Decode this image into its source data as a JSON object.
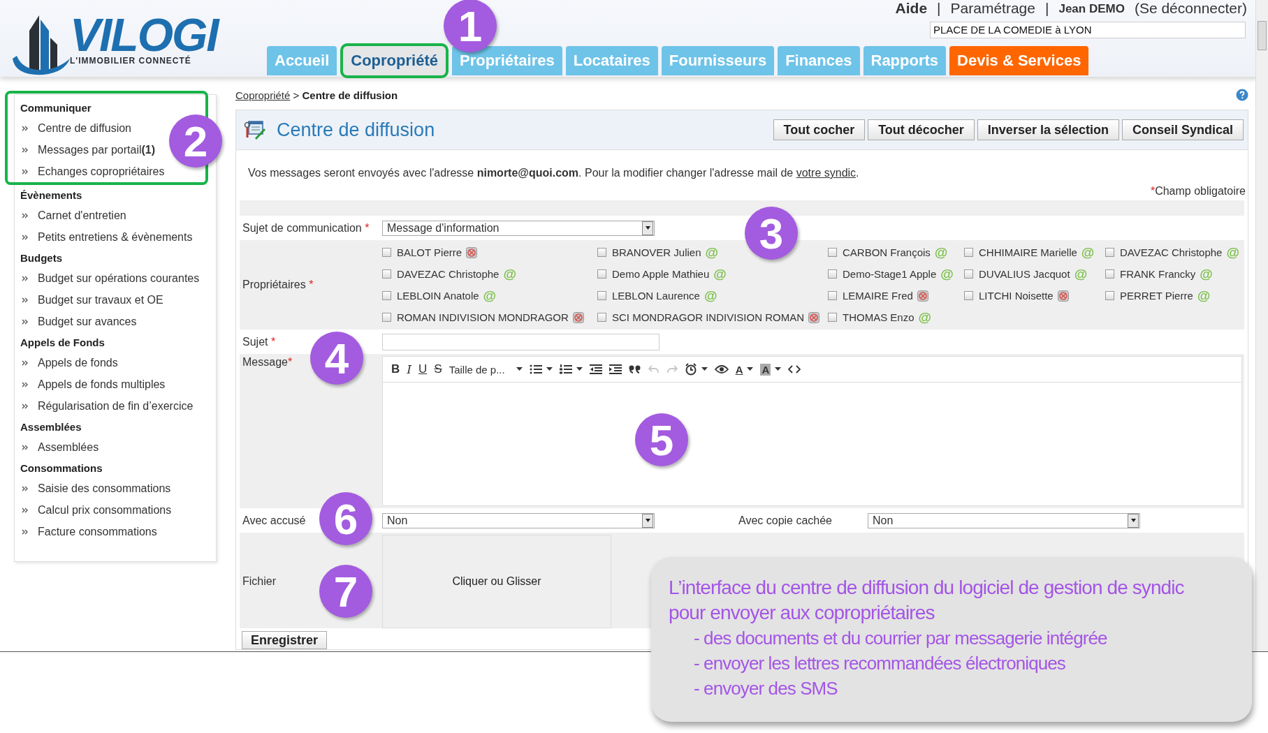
{
  "header": {
    "logo": {
      "name": "VILOGI",
      "tagline": "L'IMMOBILIER CONNECTÉ"
    },
    "top_bar": [
      {
        "kind": "link",
        "label": "Aide",
        "bold": true
      },
      {
        "kind": "separator",
        "label": "|",
        "bold": false
      },
      {
        "kind": "link",
        "label": "Paramétrage",
        "bold": false
      },
      {
        "kind": "separator",
        "label": "|",
        "bold": false
      },
      {
        "kind": "user",
        "label": "Jean DEMO",
        "bold": true
      },
      {
        "kind": "link",
        "label": "(Se déconnecter)",
        "bold": false
      }
    ],
    "location_field": {
      "value": "PLACE DE LA COMEDIE à LYON"
    }
  },
  "tabs": [
    {
      "label": "Accueil",
      "selected": false,
      "highlighted": false,
      "kind": "normal"
    },
    {
      "label": "Copropriété",
      "selected": true,
      "highlighted": true,
      "kind": "normal"
    },
    {
      "label": "Propriétaires",
      "selected": false,
      "highlighted": false,
      "kind": "normal"
    },
    {
      "label": "Locataires",
      "selected": false,
      "highlighted": false,
      "kind": "normal"
    },
    {
      "label": "Fournisseurs",
      "selected": false,
      "highlighted": false,
      "kind": "normal"
    },
    {
      "label": "Finances",
      "selected": false,
      "highlighted": false,
      "kind": "normal"
    },
    {
      "label": "Rapports",
      "selected": false,
      "highlighted": false,
      "kind": "normal"
    },
    {
      "label": "Devis & Services",
      "selected": false,
      "highlighted": false,
      "kind": "promo"
    }
  ],
  "sidebar": {
    "sections": [
      {
        "title": "Communiquer",
        "highlighted": true,
        "items": [
          {
            "label": "Centre de diffusion"
          },
          {
            "label": "Messages par portail",
            "count": "(1)"
          },
          {
            "label": "Echanges copropriétaires"
          }
        ]
      },
      {
        "title": "Évènements",
        "highlighted": false,
        "items": [
          {
            "label": "Carnet d'entretien"
          },
          {
            "label": "Petits entretiens & évènements"
          }
        ]
      },
      {
        "title": "Budgets",
        "highlighted": false,
        "items": [
          {
            "label": "Budget sur opérations courantes"
          },
          {
            "label": "Budget sur travaux et OE"
          },
          {
            "label": "Budget sur avances"
          }
        ]
      },
      {
        "title": "Appels de Fonds",
        "highlighted": false,
        "items": [
          {
            "label": "Appels de fonds"
          },
          {
            "label": "Appels de fonds multiples"
          },
          {
            "label": "Régularisation de fin d’exercice"
          }
        ]
      },
      {
        "title": "Assemblées",
        "highlighted": false,
        "items": [
          {
            "label": "Assemblées"
          }
        ]
      },
      {
        "title": "Consommations",
        "highlighted": false,
        "items": [
          {
            "label": "Saisie des consommations"
          },
          {
            "label": "Calcul prix consommations"
          },
          {
            "label": "Facture consommations"
          }
        ]
      }
    ]
  },
  "breadcrumb": {
    "link": "Copropriété",
    "separator": ">",
    "current": "Centre de diffusion"
  },
  "panel": {
    "title": "Centre de diffusion",
    "buttons": [
      "Tout cocher",
      "Tout décocher",
      "Inverser la sélection",
      "Conseil Syndical"
    ],
    "notice": {
      "text": "Vos messages seront envoyés avec l'adresse **nimorte@quoi.com**. Pour la modifier changer l'adresse mail de ",
      "link": "votre syndic",
      "after": "."
    },
    "required_note": {
      "mark": "*",
      "text": "Champ obligatoire"
    }
  },
  "form": {
    "required_mark": "*",
    "subject_type": {
      "label": "Sujet de communication",
      "required": true,
      "value": "Message d'information"
    },
    "owners": {
      "label": "Propriétaires",
      "required": true,
      "email_mark": "@",
      "items": [
        {
          "name": "BALOT Pierre",
          "checked": false,
          "has_email": false
        },
        {
          "name": "BRANOVER Julien",
          "checked": false,
          "has_email": true
        },
        {
          "name": "CARBON François",
          "checked": false,
          "has_email": true
        },
        {
          "name": "CHHIMAIRE Marielle",
          "checked": false,
          "has_email": true
        },
        {
          "name": "DAVEZAC Christophe",
          "checked": false,
          "has_email": true
        },
        {
          "name": "DAVEZAC Christophe",
          "checked": false,
          "has_email": true
        },
        {
          "name": "Demo Apple Mathieu",
          "checked": false,
          "has_email": true
        },
        {
          "name": "Demo-Stage1 Apple",
          "checked": false,
          "has_email": true
        },
        {
          "name": "DUVALIUS Jacquot",
          "checked": false,
          "has_email": true
        },
        {
          "name": "FRANK Francky",
          "checked": false,
          "has_email": true
        },
        {
          "name": "LEBLOIN Anatole",
          "checked": false,
          "has_email": true
        },
        {
          "name": "LEBLON Laurence",
          "checked": false,
          "has_email": true
        },
        {
          "name": "LEMAIRE Fred",
          "checked": false,
          "has_email": false
        },
        {
          "name": "LITCHI Noisette",
          "checked": false,
          "has_email": false
        },
        {
          "name": "PERRET Pierre",
          "checked": false,
          "has_email": true
        },
        {
          "name": "ROMAN INDIVISION MONDRAGOR",
          "checked": false,
          "has_email": false
        },
        {
          "name": "SCI MONDRAGOR INDIVISION ROMAN",
          "checked": false,
          "has_email": false
        },
        {
          "name": "THOMAS Enzo",
          "checked": false,
          "has_email": true
        }
      ]
    },
    "subject": {
      "label": "Sujet",
      "required": true
    },
    "message": {
      "label": "Message",
      "required": true,
      "toolbar": [
        {
          "kind": "bold",
          "label": "B",
          "dropdown": false,
          "disabled": false
        },
        {
          "kind": "italic",
          "label": "I",
          "dropdown": false,
          "disabled": false
        },
        {
          "kind": "underline",
          "label": "U",
          "dropdown": false,
          "disabled": false
        },
        {
          "kind": "strike",
          "label": "S",
          "dropdown": false,
          "disabled": false
        },
        {
          "kind": "size",
          "label": "Taille de p...",
          "dropdown": true,
          "disabled": false
        },
        {
          "kind": "bullets",
          "dropdown": true,
          "disabled": false
        },
        {
          "kind": "numbers",
          "dropdown": true,
          "disabled": false
        },
        {
          "kind": "outdent",
          "dropdown": false,
          "disabled": false
        },
        {
          "kind": "indent",
          "dropdown": false,
          "disabled": false
        },
        {
          "kind": "quote",
          "dropdown": false,
          "disabled": false
        },
        {
          "kind": "undo",
          "dropdown": false,
          "disabled": true
        },
        {
          "kind": "redo",
          "dropdown": false,
          "disabled": true
        },
        {
          "kind": "clock",
          "dropdown": true,
          "disabled": false
        },
        {
          "kind": "eye",
          "dropdown": false,
          "disabled": false
        },
        {
          "kind": "text-color",
          "label": "A",
          "dropdown": true,
          "disabled": false
        },
        {
          "kind": "highlight",
          "label": "A",
          "dropdown": true,
          "disabled": false
        },
        {
          "kind": "code",
          "dropdown": false,
          "disabled": false
        }
      ]
    },
    "receipt": {
      "label": "Avec accusé",
      "value": "Non"
    },
    "bcc": {
      "label": "Avec copie cachée",
      "value": "Non"
    },
    "file": {
      "label": "Fichier",
      "dropzone": "Cliquer ou Glisser"
    },
    "save_button": "Enregistrer"
  },
  "annotations": [
    "1",
    "2",
    "3",
    "4",
    "5",
    "6",
    "7"
  ],
  "callout": {
    "lines": [
      {
        "kind": "heading",
        "text": "L’interface du centre de diffusion du logiciel de gestion de syndic"
      },
      {
        "kind": "heading",
        "text": "pour envoyer aux copropriétaires"
      },
      {
        "kind": "bullet",
        "text": "- des documents et du courrier par messagerie intégrée"
      },
      {
        "kind": "bullet",
        "text": "- envoyer les lettres recommandées électroniques"
      },
      {
        "kind": "bullet",
        "text": "- envoyer des SMS"
      }
    ]
  }
}
